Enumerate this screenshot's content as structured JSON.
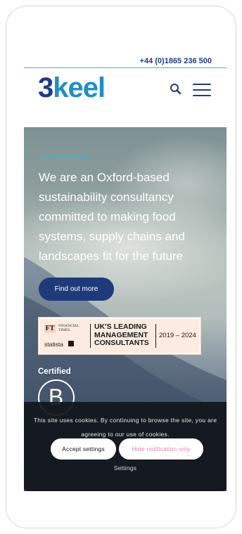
{
  "header": {
    "phone": "+44 (0)1865 236 500",
    "logo": {
      "part1": "3",
      "part2": "keel"
    },
    "search_icon": "search-icon",
    "menu_icon": "hamburger-menu-icon"
  },
  "hero": {
    "tagline": "We are an Oxford-based sustainability consultancy committed to making food systems, supply chains and landscapes fit for the future",
    "cta_label": "Find out more"
  },
  "ft_badge": {
    "ft_mark": "FT",
    "ft_name": "FINANCIAL TIMES",
    "statista": "statista",
    "title": "UK'S LEADING MANAGEMENT CONSULTANTS",
    "years": "2019 – 2024"
  },
  "certified": {
    "label": "Certified",
    "b_letter": "B"
  },
  "cookie_banner": {
    "message": "This site uses cookies. By continuing to browse the site, you are agreeing to our use of cookies.",
    "accept_label": "Accept settings",
    "hide_label": "Hide notification only",
    "settings_label": "Settings"
  },
  "colors": {
    "brand_navy": "#1f3a8a",
    "brand_blue": "#1f8fc2",
    "accent_teal": "#45b1c2",
    "cta_bg": "#1e3a7a",
    "hide_text": "#ef7ea3"
  }
}
